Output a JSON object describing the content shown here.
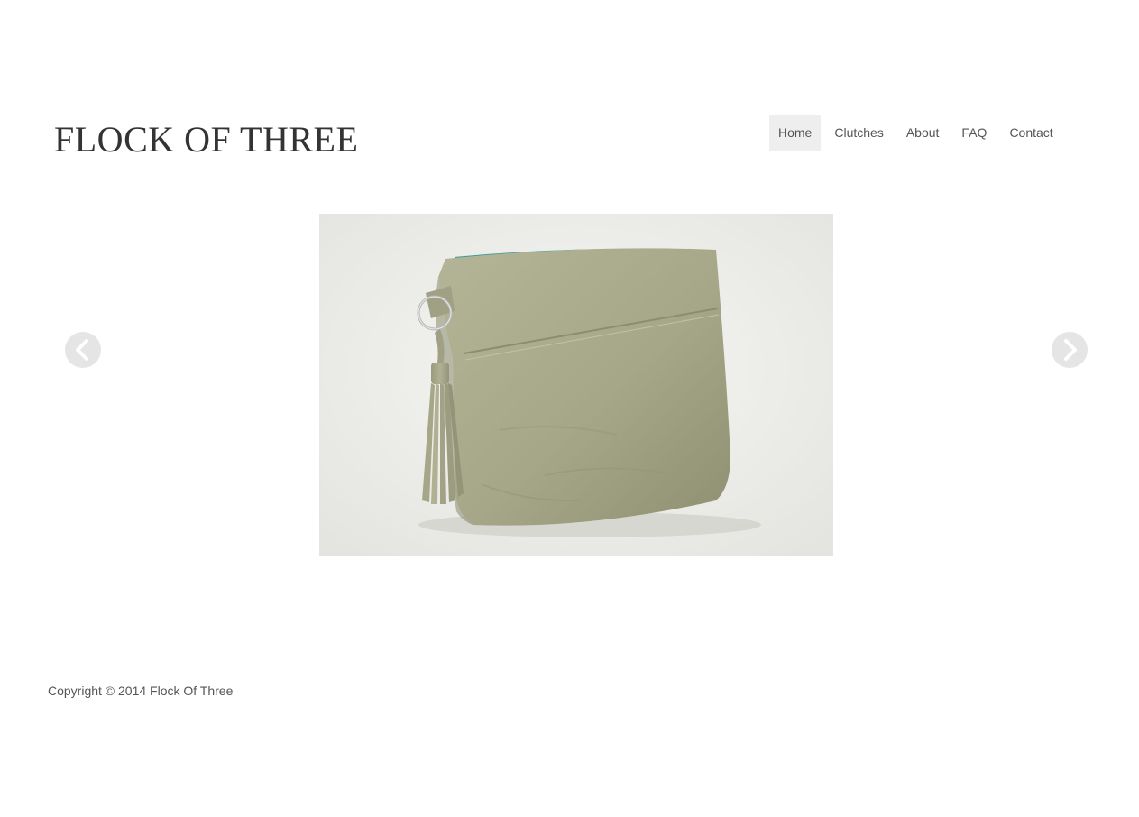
{
  "site": {
    "logo_text": "FLOCK OF THREE"
  },
  "nav": {
    "items": [
      {
        "label": "Home",
        "active": true
      },
      {
        "label": "Clutches",
        "active": false
      },
      {
        "label": "About",
        "active": false
      },
      {
        "label": "FAQ",
        "active": false
      },
      {
        "label": "Contact",
        "active": false
      }
    ]
  },
  "slider": {
    "prev_icon": "chevron-left-icon",
    "next_icon": "chevron-right-icon",
    "image_subject": "sage leather clutch with tassel"
  },
  "colors": {
    "clutch": "#a8a88a",
    "clutch_shadow": "#8f8f72",
    "arrow_bg": "#e5e5e5",
    "active_nav_bg": "#eeeeee"
  },
  "footer": {
    "copyright": "Copyright © 2014 Flock Of Three"
  }
}
